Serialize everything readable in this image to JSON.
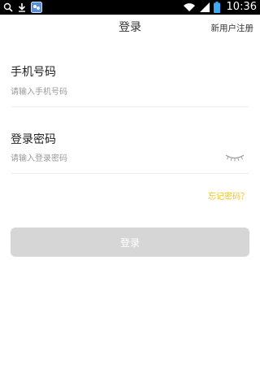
{
  "status_bar": {
    "time": "10:36",
    "left_icons": [
      "search-icon",
      "download-icon",
      "app-notification-icon"
    ],
    "right_icons": [
      "wifi-icon",
      "signal-icon",
      "battery-icon"
    ]
  },
  "header": {
    "title": "登录",
    "register_link": "新用户注册"
  },
  "form": {
    "phone": {
      "label": "手机号码",
      "placeholder": "请输入手机号码",
      "value": ""
    },
    "password": {
      "label": "登录密码",
      "placeholder": "请输入登录密码",
      "value": "",
      "toggle_icon": "eye-closed-icon"
    },
    "forgot_password": "忘记密码？",
    "login_button": "登录"
  },
  "colors": {
    "accent": "#f0c419",
    "button_disabled": "#d6d6d6",
    "status_bar": "#000000"
  }
}
